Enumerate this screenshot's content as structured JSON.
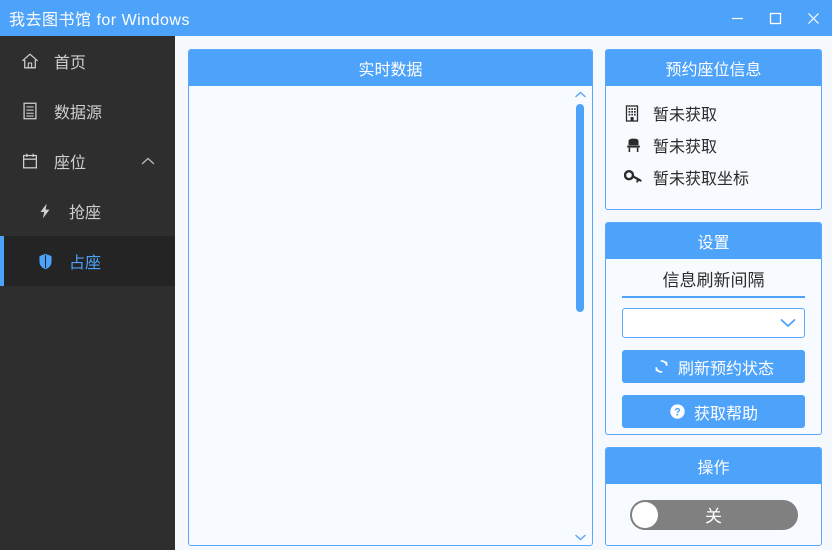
{
  "window": {
    "title": "我去图书馆  for Windows",
    "controls": [
      {
        "name": "minimize",
        "glyph": "minimize-icon"
      },
      {
        "name": "maximize",
        "glyph": "maximize-icon"
      },
      {
        "name": "close",
        "glyph": "close-icon"
      }
    ]
  },
  "colors": {
    "accent": "#4da2fa",
    "titlebar": "#4da2fa",
    "sidebar_bg": "#2e2e2e",
    "sidebar_active_bg": "#242424",
    "page_bg": "#f5f8fc",
    "panel_bg": "#f7faff",
    "toggle_off": "#808080"
  },
  "sidebar": {
    "items": [
      {
        "label": "首页",
        "icon": "home-icon",
        "active": false,
        "sub": false
      },
      {
        "label": "数据源",
        "icon": "database-list-icon",
        "active": false,
        "sub": false
      },
      {
        "label": "座位",
        "icon": "calendar-icon",
        "active": false,
        "sub": false,
        "chevron": "chevron-up-icon"
      },
      {
        "label": "抢座",
        "icon": "lightning-icon",
        "active": false,
        "sub": true
      },
      {
        "label": "占座",
        "icon": "shield-icon",
        "active": true,
        "sub": true
      }
    ]
  },
  "realtime": {
    "title": "实时数据",
    "content": "",
    "scrollbar": {
      "up_icon": "chevron-up-icon",
      "down_icon": "chevron-down-icon"
    }
  },
  "reservation": {
    "title": "预约座位信息",
    "rows": [
      {
        "icon": "building-icon",
        "text": "暂未获取"
      },
      {
        "icon": "chair-icon",
        "text": "暂未获取"
      },
      {
        "icon": "key-icon",
        "text": "暂未获取坐标"
      }
    ]
  },
  "settings": {
    "title": "设置",
    "interval_label": "信息刷新间隔",
    "interval_value": "",
    "interval_placeholder": "",
    "select_arrow_icon": "chevron-down-icon",
    "refresh_button": {
      "label": "刷新预约状态",
      "icon": "sync-icon"
    },
    "help_button": {
      "label": "获取帮助",
      "icon": "question-circle-icon"
    }
  },
  "operation": {
    "title": "操作",
    "toggle": {
      "state_label": "关",
      "on": false
    }
  }
}
